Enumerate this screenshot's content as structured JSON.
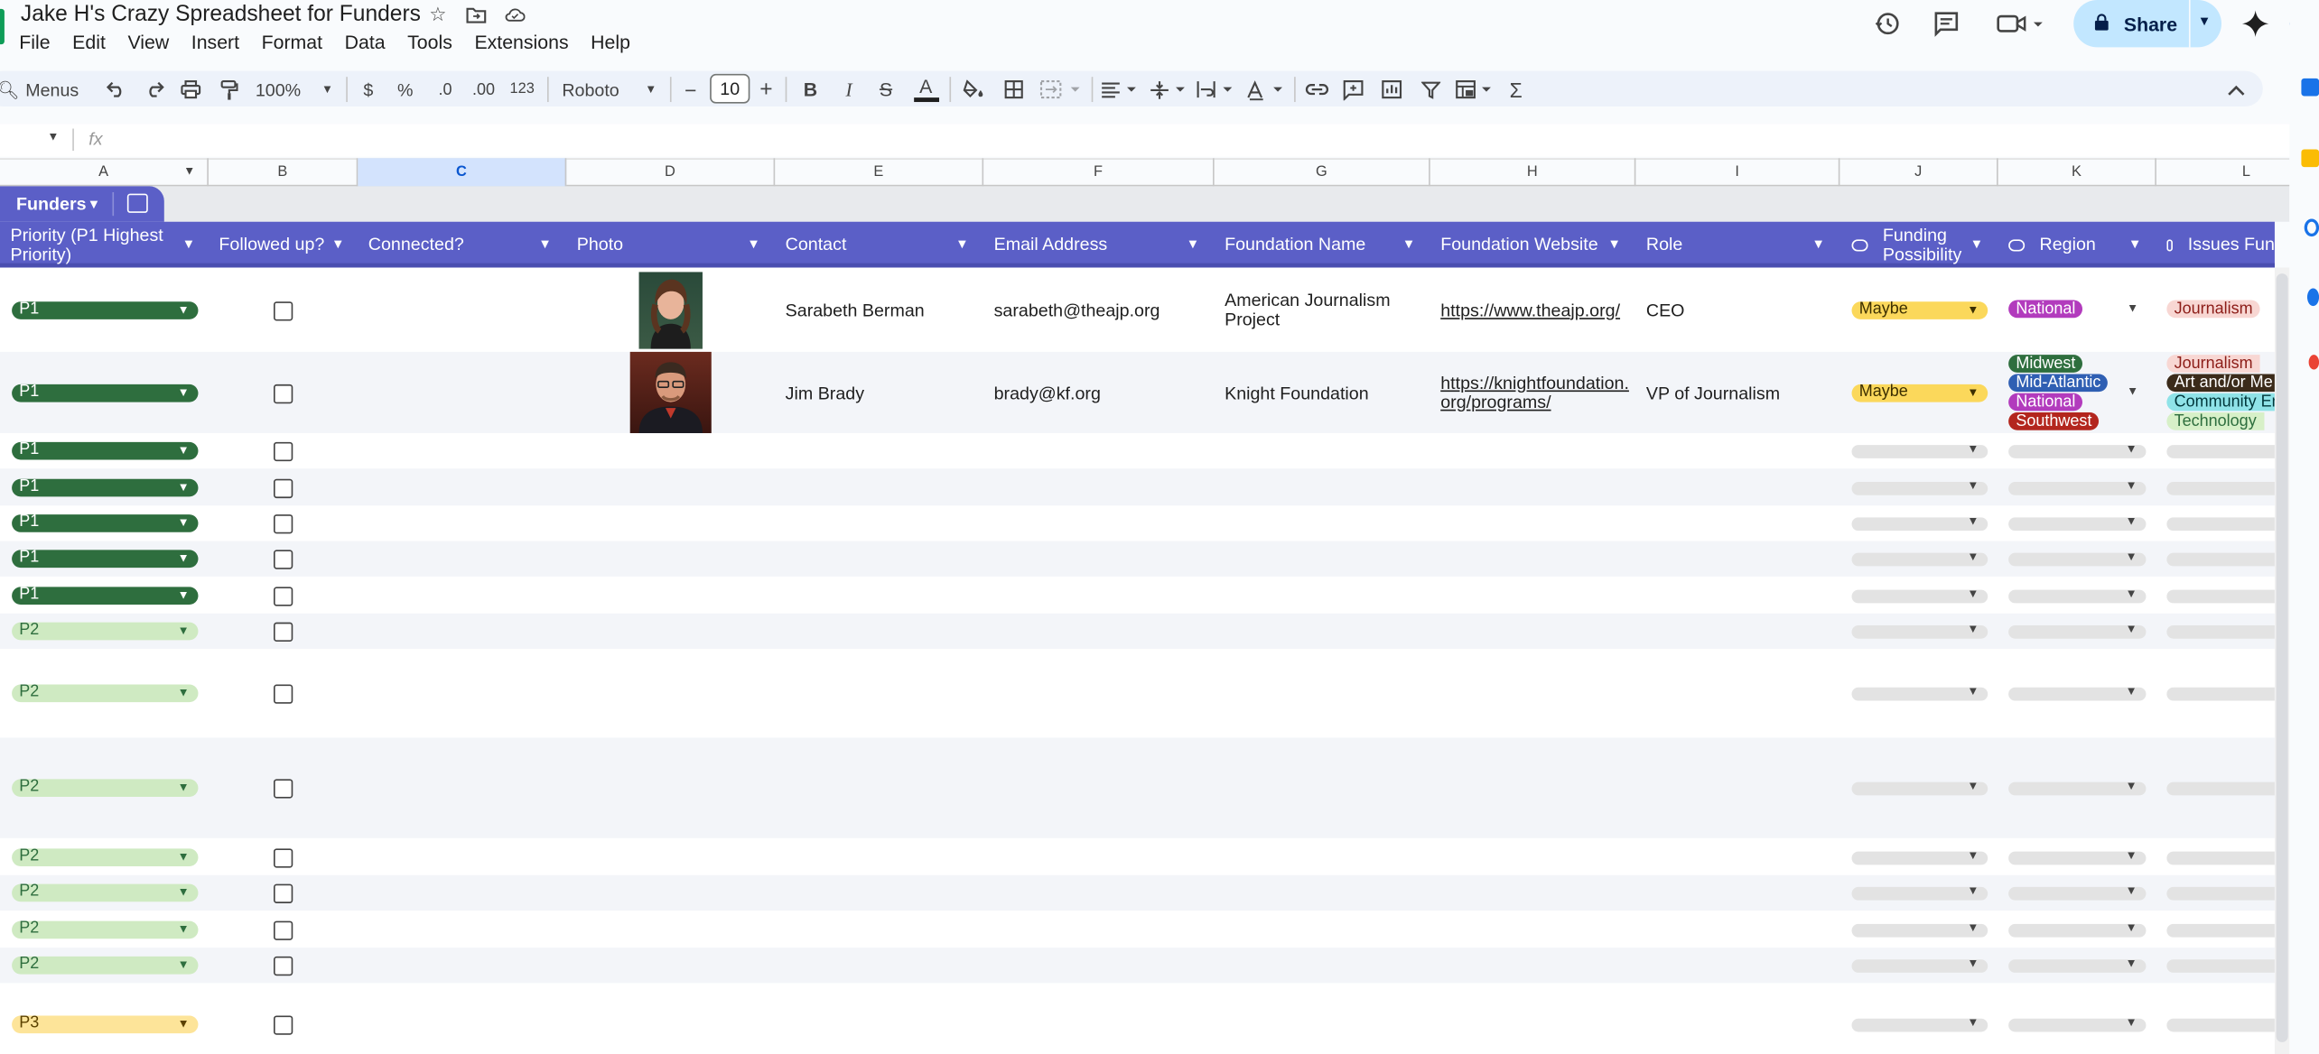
{
  "doc": {
    "title": "Jake H's Crazy Spreadsheet for Funders"
  },
  "menu": [
    "File",
    "Edit",
    "View",
    "Insert",
    "Format",
    "Data",
    "Tools",
    "Extensions",
    "Help"
  ],
  "share": {
    "label": "Share"
  },
  "toolbar": {
    "menus": "Menus",
    "zoom": "100%",
    "currency": "$",
    "percent": "%",
    "dec_decrease": ".0",
    "dec_increase": ".00",
    "number_format": "123",
    "font": "Roboto",
    "font_size": "10",
    "bold": "B",
    "italic": "I",
    "strike": "S",
    "text_color": "A",
    "sum": "Σ"
  },
  "formula_bar": {
    "fx": "fx"
  },
  "columns": [
    "A",
    "B",
    "C",
    "D",
    "E",
    "F",
    "G",
    "H",
    "I",
    "J",
    "K",
    "L"
  ],
  "table": {
    "name": "Funders",
    "headers": {
      "priority": "Priority (P1 Highest Priority)",
      "followed": "Followed up?",
      "connected": "Connected?",
      "photo": "Photo",
      "contact": "Contact",
      "email": "Email Address",
      "foundation": "Foundation Name",
      "website": "Foundation Website",
      "role": "Role",
      "funding": "Funding Possibility",
      "region": "Region",
      "issues": "Issues Fun"
    },
    "rows": [
      {
        "priority": "P1",
        "contact": "Sarabeth Berman",
        "email": "sarabeth@theajp.org",
        "foundation_l1": "American Journalism",
        "foundation_l2": "Project",
        "website_l1": "https://www.theajp.org/",
        "role": "CEO",
        "funding": "Maybe",
        "regions": [
          "National"
        ],
        "issues": [
          "Journalism"
        ]
      },
      {
        "priority": "P1",
        "contact": "Jim Brady",
        "email": "brady@kf.org",
        "foundation_l1": "Knight Foundation",
        "website_l1": "https://knightfoundation.",
        "website_l2": "org/programs/",
        "role": "VP of Journalism",
        "funding": "Maybe",
        "regions": [
          "Midwest",
          "Mid-Atlantic",
          "National",
          "Southwest"
        ],
        "issues": [
          "Journalism",
          "Art and/or Me",
          "Community En",
          "Technology"
        ]
      },
      {
        "priority": "P1"
      },
      {
        "priority": "P1"
      },
      {
        "priority": "P1"
      },
      {
        "priority": "P1"
      },
      {
        "priority": "P1"
      },
      {
        "priority": "P2"
      },
      {
        "priority": "P2"
      },
      {
        "priority": "P2"
      },
      {
        "priority": "P2"
      },
      {
        "priority": "P2"
      },
      {
        "priority": "P2"
      },
      {
        "priority": "P2"
      },
      {
        "priority": "P3"
      }
    ]
  },
  "colors": {
    "header": "#5b5fc7",
    "p1": "#2e6e3e",
    "p2": "#cfeac2",
    "p3": "#fde499",
    "maybe": "#fbd85b",
    "national": "#b23bbd",
    "midwest": "#2e6e3e",
    "mid_atlantic": "#2f5fb3",
    "southwest": "#b3261e"
  }
}
